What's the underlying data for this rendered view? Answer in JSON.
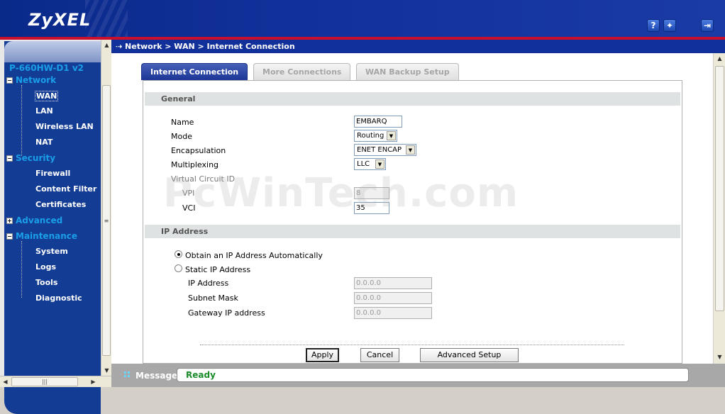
{
  "header": {
    "logo": "ZyXEL",
    "help_icon": "?",
    "wizard_icon": "wand-icon",
    "logout_icon": "logout-icon"
  },
  "nav": {
    "device": "P-660HW-D1 v2",
    "sections": [
      {
        "label": "Network",
        "expanded": true,
        "items": [
          "WAN",
          "LAN",
          "Wireless LAN",
          "NAT"
        ]
      },
      {
        "label": "Security",
        "expanded": true,
        "items": [
          "Firewall",
          "Content Filter",
          "Certificates"
        ]
      },
      {
        "label": "Advanced",
        "expanded": false,
        "items": []
      },
      {
        "label": "Maintenance",
        "expanded": true,
        "items": [
          "System",
          "Logs",
          "Tools",
          "Diagnostic"
        ]
      }
    ],
    "selected": "WAN"
  },
  "breadcrumb": "Network > WAN > Internet Connection",
  "tabs": [
    {
      "label": "Internet Connection",
      "active": true
    },
    {
      "label": "More Connections",
      "active": false
    },
    {
      "label": "WAN Backup Setup",
      "active": false
    }
  ],
  "general": {
    "heading": "General",
    "name_label": "Name",
    "name_value": "EMBARQ",
    "mode_label": "Mode",
    "mode_value": "Routing",
    "encap_label": "Encapsulation",
    "encap_value": "ENET ENCAP",
    "mux_label": "Multiplexing",
    "mux_value": "LLC",
    "vc_label": "Virtual Circuit ID",
    "vpi_label": "VPI",
    "vpi_value": "8",
    "vci_label": "VCI",
    "vci_value": "35"
  },
  "ip": {
    "heading": "IP Address",
    "auto_label": "Obtain an IP Address Automatically",
    "static_label": "Static IP Address",
    "selected": "auto",
    "ip_label": "IP Address",
    "ip_value": "0.0.0.0",
    "mask_label": "Subnet Mask",
    "mask_value": "0.0.0.0",
    "gw_label": "Gateway IP address",
    "gw_value": "0.0.0.0"
  },
  "buttons": {
    "apply": "Apply",
    "cancel": "Cancel",
    "advanced": "Advanced Setup"
  },
  "watermark": "PcWinTech.com",
  "message": {
    "label": "Message",
    "status": "Ready"
  },
  "colors": {
    "header_blue": "#12309a",
    "accent_red": "#c8102e",
    "nav_link": "#1a9ee8",
    "status_green": "#1a8c2a"
  }
}
